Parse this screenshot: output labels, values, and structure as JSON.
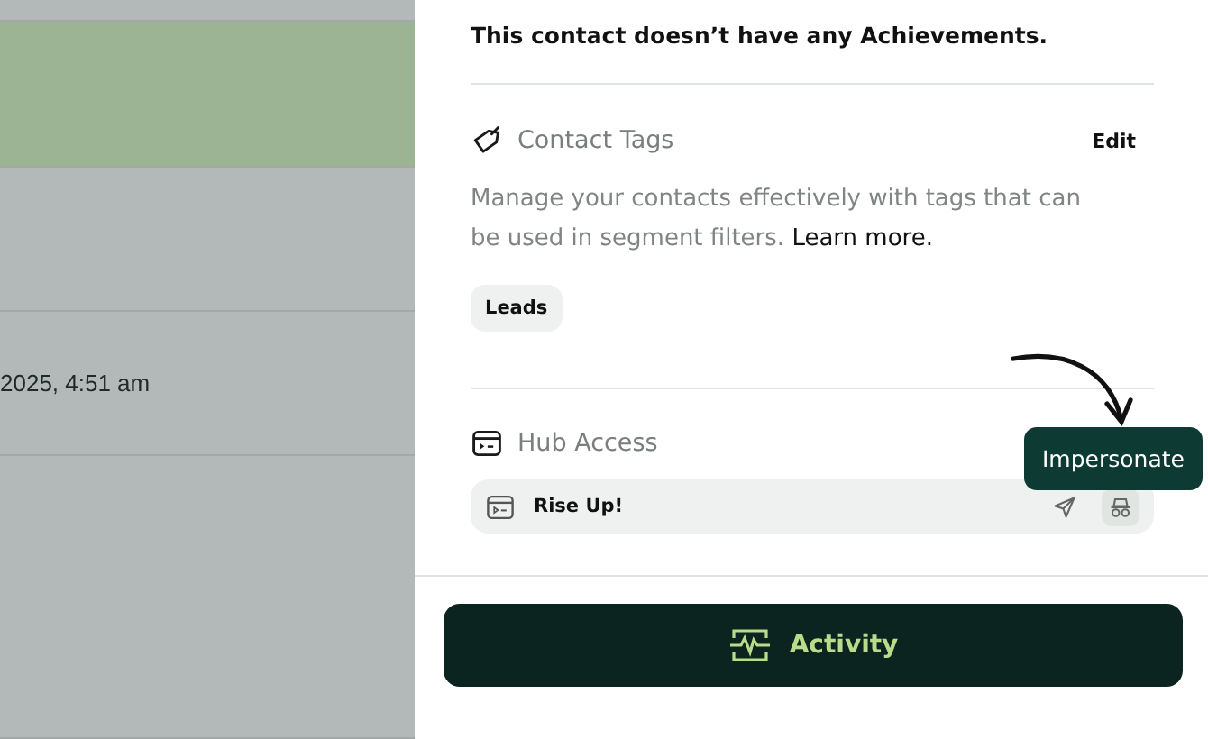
{
  "background_rows": [
    {
      "highlighted": false
    },
    {
      "highlighted": true
    },
    {
      "highlighted": false
    },
    {
      "highlighted": false,
      "text": "2025, 4:51 am"
    },
    {
      "highlighted": false
    }
  ],
  "panel": {
    "achievements_message": "This contact doesn’t have any Achievements.",
    "contact_tags": {
      "title": "Contact Tags",
      "edit": "Edit",
      "description": "Manage your contacts effectively with tags that can be used in segment filters.",
      "link": "Learn more.",
      "tags": [
        "Leads"
      ]
    },
    "hub_access": {
      "title": "Hub Access",
      "hubs": [
        {
          "name": "Rise Up!"
        }
      ],
      "tooltip": "Impersonate"
    },
    "activity_button": "Activity"
  }
}
